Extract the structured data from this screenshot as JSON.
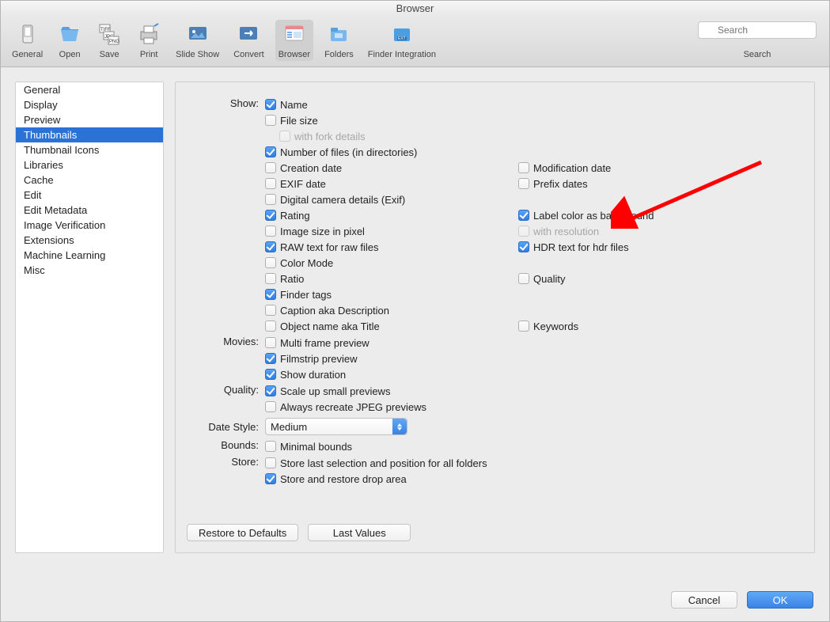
{
  "window": {
    "title": "Browser"
  },
  "toolbar": {
    "items": [
      {
        "label": "General"
      },
      {
        "label": "Open"
      },
      {
        "label": "Save"
      },
      {
        "label": "Print"
      },
      {
        "label": "Slide Show"
      },
      {
        "label": "Convert"
      },
      {
        "label": "Browser"
      },
      {
        "label": "Folders"
      },
      {
        "label": "Finder Integration"
      }
    ],
    "selected_index": 6,
    "search": {
      "placeholder": "Search",
      "label": "Search"
    }
  },
  "sidebar": {
    "items": [
      "General",
      "Display",
      "Preview",
      "Thumbnails",
      "Thumbnail Icons",
      "Libraries",
      "Cache",
      "Edit",
      "Edit Metadata",
      "Image Verification",
      "Extensions",
      "Machine Learning",
      "Misc"
    ],
    "selected_index": 3
  },
  "sections": {
    "show": {
      "label": "Show:",
      "left": [
        {
          "label": "Name",
          "checked": true
        },
        {
          "label": "File size",
          "checked": false
        },
        {
          "label": "with fork details",
          "checked": false,
          "disabled": true,
          "indent": true
        },
        {
          "label": "Number of files (in directories)",
          "checked": true
        },
        {
          "label": "Creation date",
          "checked": false
        },
        {
          "label": "EXIF date",
          "checked": false
        },
        {
          "label": "Digital camera details (Exif)",
          "checked": false
        },
        {
          "label": "Rating",
          "checked": true
        },
        {
          "label": "Image size in pixel",
          "checked": false
        },
        {
          "label": "RAW text for raw files",
          "checked": true
        },
        {
          "label": "Color Mode",
          "checked": false
        },
        {
          "label": "Ratio",
          "checked": false
        },
        {
          "label": "Finder tags",
          "checked": true
        },
        {
          "label": "Caption aka Description",
          "checked": false
        },
        {
          "label": "Object name aka Title",
          "checked": false
        }
      ],
      "right": [
        null,
        null,
        null,
        null,
        {
          "label": "Modification date",
          "checked": false
        },
        {
          "label": "Prefix dates",
          "checked": false
        },
        null,
        {
          "label": "Label color as background",
          "checked": true
        },
        {
          "label": "with resolution",
          "checked": false,
          "disabled": true
        },
        {
          "label": "HDR text for hdr files",
          "checked": true
        },
        null,
        {
          "label": "Quality",
          "checked": false
        },
        null,
        null,
        {
          "label": "Keywords",
          "checked": false
        }
      ]
    },
    "movies": {
      "label": "Movies:",
      "items": [
        {
          "label": "Multi frame preview",
          "checked": false
        },
        {
          "label": "Filmstrip preview",
          "checked": true
        },
        {
          "label": "Show duration",
          "checked": true
        }
      ]
    },
    "quality": {
      "label": "Quality:",
      "items": [
        {
          "label": "Scale up small previews",
          "checked": true
        },
        {
          "label": "Always recreate JPEG previews",
          "checked": false
        }
      ]
    },
    "date_style": {
      "label": "Date Style:",
      "value": "Medium"
    },
    "bounds": {
      "label": "Bounds:",
      "item": {
        "label": "Minimal bounds",
        "checked": false
      }
    },
    "store": {
      "label": "Store:",
      "items": [
        {
          "label": "Store last selection and position for all folders",
          "checked": false
        },
        {
          "label": "Store and restore drop area",
          "checked": true
        }
      ]
    }
  },
  "content_buttons": {
    "restore": "Restore to Defaults",
    "last": "Last Values"
  },
  "footer": {
    "cancel": "Cancel",
    "ok": "OK"
  }
}
